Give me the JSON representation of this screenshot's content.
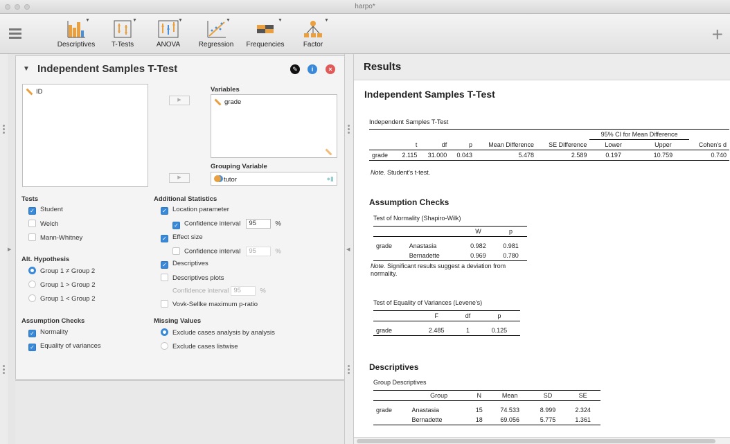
{
  "window": {
    "title": "harpo*"
  },
  "ribbon": {
    "buttons": [
      {
        "label": "Descriptives",
        "icon": "descriptives-icon"
      },
      {
        "label": "T-Tests",
        "icon": "ttests-icon"
      },
      {
        "label": "ANOVA",
        "icon": "anova-icon"
      },
      {
        "label": "Regression",
        "icon": "regression-icon"
      },
      {
        "label": "Frequencies",
        "icon": "frequencies-icon"
      },
      {
        "label": "Factor",
        "icon": "factor-icon"
      }
    ],
    "add_label": "+"
  },
  "editor": {
    "title": "Independent Samples T-Test",
    "source_vars": [
      "ID"
    ],
    "variables_label": "Variables",
    "variables": [
      "grade"
    ],
    "grouping_label": "Grouping Variable",
    "grouping": "tutor",
    "tests": {
      "label": "Tests",
      "student": "Student",
      "welch": "Welch",
      "mann": "Mann-Whitney"
    },
    "hyp": {
      "label": "Alt. Hypothesis",
      "o1": "Group 1 ≠ Group 2",
      "o2": "Group 1 > Group 2",
      "o3": "Group 1 < Group 2"
    },
    "assump": {
      "label": "Assumption Checks",
      "normality": "Normality",
      "equality": "Equality of variances"
    },
    "addstats": {
      "label": "Additional Statistics",
      "location": "Location parameter",
      "ci": "Confidence interval",
      "ci_value": "95",
      "pct": "%",
      "effect": "Effect size",
      "ci2": "Confidence interval",
      "ci2_value": "95",
      "desc": "Descriptives",
      "descplots": "Descriptives plots",
      "ci3": "Confidence interval",
      "ci3_value": "95",
      "vovk": "Vovk-Sellke maximum p-ratio"
    },
    "missing": {
      "label": "Missing Values",
      "o1": "Exclude cases analysis by analysis",
      "o2": "Exclude cases listwise"
    }
  },
  "results": {
    "header": "Results",
    "title": "Independent Samples T-Test",
    "ttest": {
      "caption": "Independent Samples T-Test",
      "ci_header": "95% CI for Mean Difference",
      "cols": [
        "",
        "t",
        "df",
        "p",
        "Mean Difference",
        "SE Difference",
        "Lower",
        "Upper",
        "Cohen's d"
      ],
      "row": [
        "grade",
        "2.115",
        "31.000",
        "0.043",
        "5.478",
        "2.589",
        "0.197",
        "10.759",
        "0.740"
      ],
      "note_label": "Note.",
      "note": " Student's t-test."
    },
    "assump_title": "Assumption Checks",
    "normality": {
      "caption": "Test of Normality (Shapiro-Wilk)",
      "cols": [
        "",
        "",
        "W",
        "p"
      ],
      "rows": [
        [
          "grade",
          "Anastasia",
          "0.982",
          "0.981"
        ],
        [
          "",
          "Bernadette",
          "0.969",
          "0.780"
        ]
      ],
      "note_label": "Note.",
      "note1": " Significant results suggest a deviation from",
      "note2": "normality."
    },
    "levene": {
      "caption": "Test of Equality of Variances (Levene's)",
      "cols": [
        "",
        "F",
        "df",
        "p"
      ],
      "row": [
        "grade",
        "2.485",
        "1",
        "0.125"
      ]
    },
    "desc_title": "Descriptives",
    "desc": {
      "caption": "Group Descriptives",
      "cols": [
        "",
        "Group",
        "N",
        "Mean",
        "SD",
        "SE"
      ],
      "rows": [
        [
          "grade",
          "Anastasia",
          "15",
          "74.533",
          "8.999",
          "2.324"
        ],
        [
          "",
          "Bernadette",
          "18",
          "69.056",
          "5.775",
          "1.361"
        ]
      ]
    }
  }
}
